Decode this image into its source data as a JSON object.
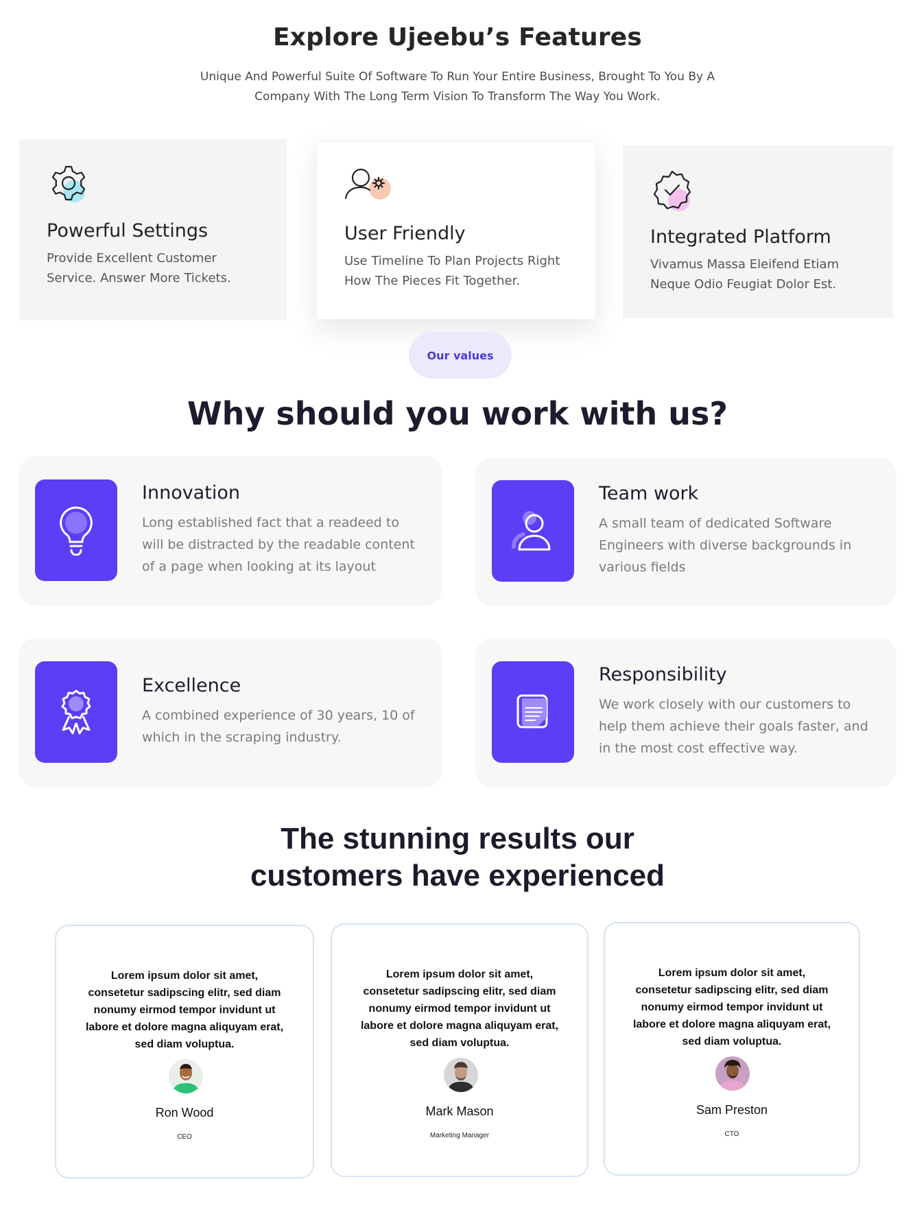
{
  "features": {
    "title": "Explore Ujeebu’s Features",
    "subtitle": "Unique And Powerful Suite Of Software To Run Your Entire Business, Brought To You By A Company With The Long Term Vision To Transform The Way You Work.",
    "cards": [
      {
        "title": "Powerful Settings",
        "description": "Provide Excellent Customer Service. Answer More Tickets.",
        "icon": "gear-icon",
        "accent": "#a8e6f3"
      },
      {
        "title": "User Friendly",
        "description": "Use Timeline To Plan Projects Right How The Pieces Fit Together.",
        "icon": "user-settings-icon",
        "accent": "#f8c9b4"
      },
      {
        "title": "Integrated Platform",
        "description": "Vivamus Massa Eleifend Etiam Neque Odio Feugiat Dolor Est.",
        "icon": "verified-badge-icon",
        "accent": "#f4c1ef"
      }
    ]
  },
  "values": {
    "pill": "Our values",
    "title": "Why should you work with us?",
    "accent": "#5d3df5",
    "items": [
      {
        "title": "Innovation",
        "description": "Long established fact that a readeed to will be distracted by the readable content of a page when looking at its layout",
        "icon": "lightbulb-icon"
      },
      {
        "title": "Team work",
        "description": "A small team of dedicated Software Engineers with diverse backgrounds in various fields",
        "icon": "user-icon"
      },
      {
        "title": "Excellence",
        "description": "A combined experience of 30 years, 10 of which in the scraping industry.",
        "icon": "award-ribbon-icon"
      },
      {
        "title": "Responsibility",
        "description": "We work closely with our customers to help them achieve their goals faster, and in the most cost effective way.",
        "icon": "document-icon"
      }
    ]
  },
  "results": {
    "title_line1": "The stunning results our",
    "title_line2": "customers have experienced",
    "testimonials": [
      {
        "quote": "Lorem ipsum dolor sit amet, consetetur sadipscing elitr, sed diam nonumy eirmod tempor invidunt ut labore et dolore magna aliquyam erat, sed diam voluptua.",
        "name": "Ron Wood",
        "role": "CEO"
      },
      {
        "quote": "Lorem ipsum dolor sit amet, consetetur sadipscing elitr, sed diam nonumy eirmod tempor invidunt ut labore et dolore magna aliquyam erat, sed diam voluptua.",
        "name": "Mark Mason",
        "role": "Marketing Manager"
      },
      {
        "quote": "Lorem ipsum dolor sit amet, consetetur sadipscing elitr, sed diam nonumy eirmod tempor invidunt ut labore et dolore magna aliquyam erat, sed diam voluptua.",
        "name": "Sam Preston",
        "role": "CTO"
      }
    ]
  }
}
